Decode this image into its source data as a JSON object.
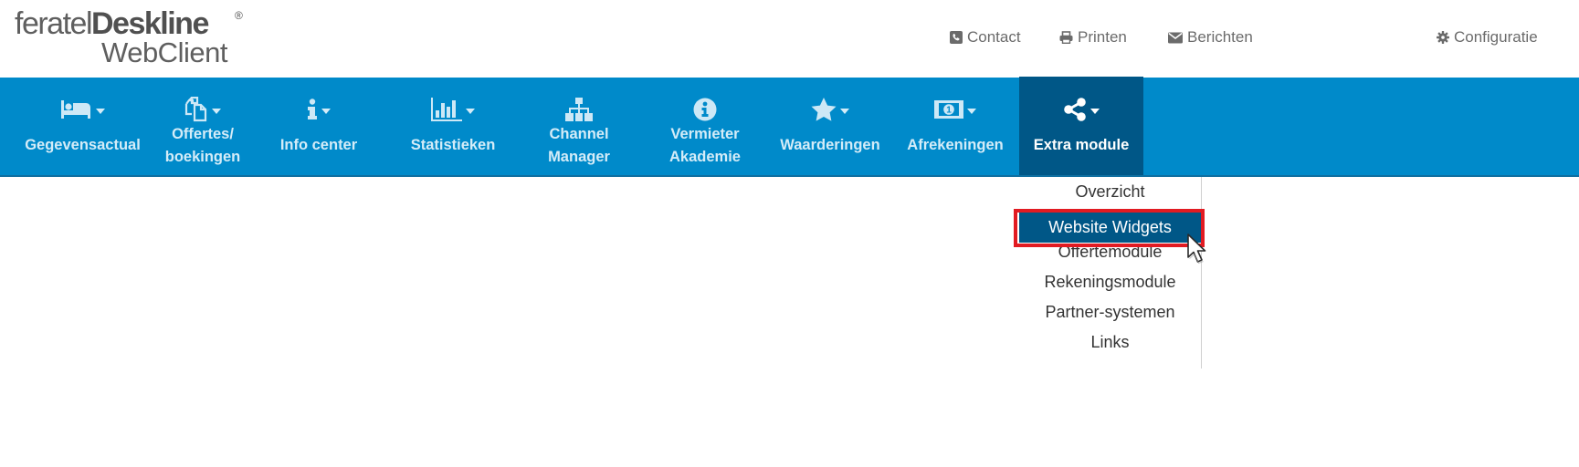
{
  "header": {
    "logo": {
      "brand_light": "feratel",
      "brand_bold": "Deskline",
      "registered": "®",
      "product": "WebClient"
    },
    "links": [
      {
        "label": "Contact",
        "icon": "phone-icon"
      },
      {
        "label": "Printen",
        "icon": "print-icon"
      },
      {
        "label": "Berichten",
        "icon": "envelope-icon"
      },
      {
        "label": "Configuratie",
        "icon": "gear-icon"
      }
    ]
  },
  "nav": {
    "items": [
      {
        "label": "Gegevensactual",
        "icon": "bed-icon",
        "has_dropdown": true
      },
      {
        "label_line1": "Offertes/",
        "label_line2": "boekingen",
        "icon": "copy-documents-icon",
        "has_dropdown": true
      },
      {
        "label": "Info center",
        "icon": "info-i-icon",
        "has_dropdown": true
      },
      {
        "label": "Statistieken",
        "icon": "bar-chart-icon",
        "has_dropdown": true
      },
      {
        "label_line1": "Channel",
        "label_line2": "Manager",
        "icon": "sitemap-icon",
        "has_dropdown": false
      },
      {
        "label_line1": "Vermieter",
        "label_line2": "Akademie",
        "icon": "info-circle-icon",
        "has_dropdown": false
      },
      {
        "label": "Waarderingen",
        "icon": "star-icon",
        "has_dropdown": true
      },
      {
        "label": "Afrekeningen",
        "icon": "money-bill-icon",
        "has_dropdown": true
      },
      {
        "label": "Extra module",
        "icon": "share-alt-icon",
        "has_dropdown": true,
        "active": true
      }
    ]
  },
  "dropdown": {
    "parent": "Extra module",
    "items": [
      {
        "label": "Overzicht"
      },
      {
        "label": "Website Widgets",
        "highlighted": true
      },
      {
        "label": "Offertemodule"
      },
      {
        "label": "Rekeningsmodule"
      },
      {
        "label": "Partner-systemen"
      },
      {
        "label": "Links"
      }
    ]
  },
  "colors": {
    "nav_background": "#008aca",
    "nav_active_background": "#005787",
    "highlight_border": "#e11b22",
    "text_gray": "#6b6b6b"
  }
}
